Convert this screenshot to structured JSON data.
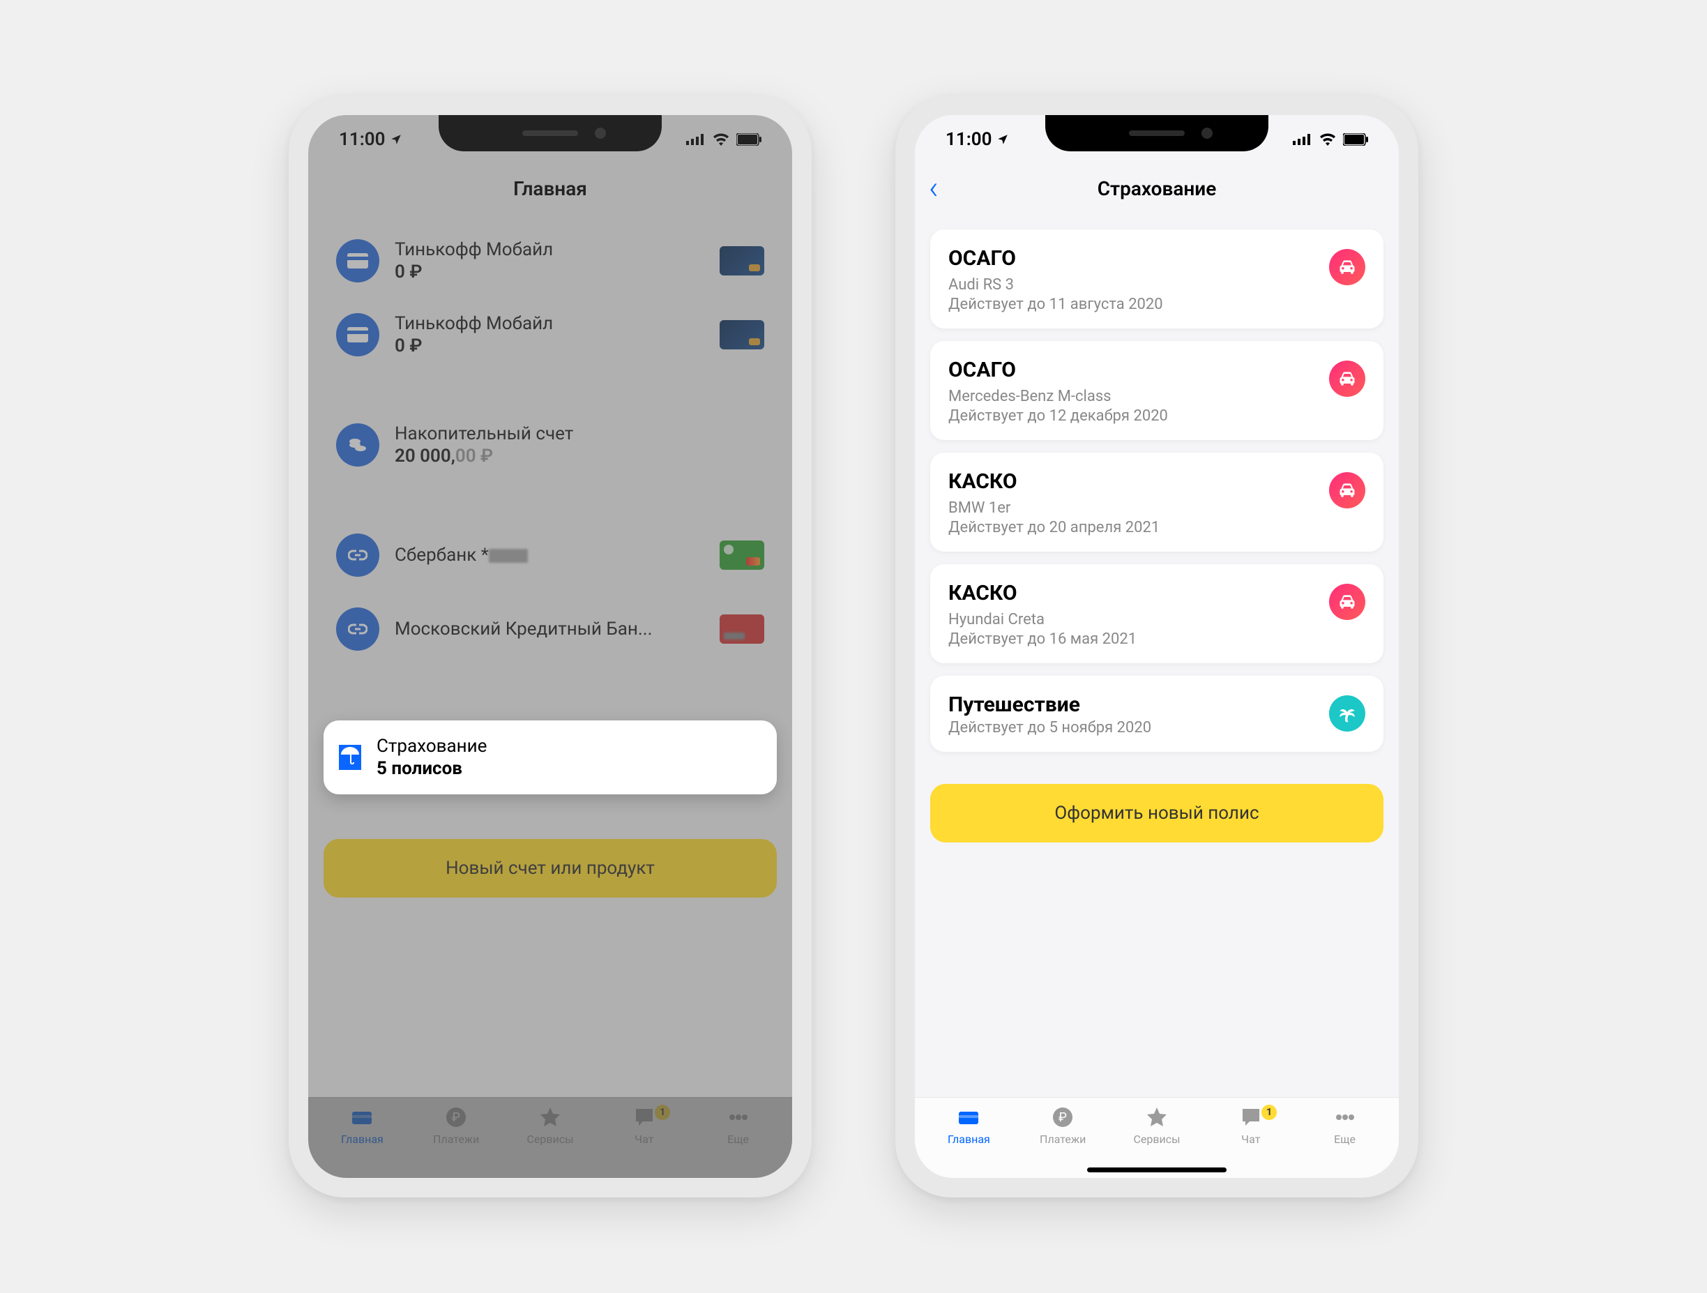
{
  "status": {
    "time": "11:00"
  },
  "phone1": {
    "title": "Главная",
    "accounts": [
      {
        "name": "Тинькофф Мобайл",
        "balance": "0 ₽",
        "card": "blue"
      },
      {
        "name": "Тинькофф Мобайл",
        "balance": "0 ₽",
        "card": "blue"
      }
    ],
    "savings": {
      "name": "Накопительный счет",
      "amount_main": "20 000,",
      "amount_fraction": "00 ₽"
    },
    "linked": [
      {
        "name": "Сбербанк *",
        "censored": "",
        "card": "green"
      },
      {
        "name": "Московский Кредитный Бан...",
        "card": "red"
      }
    ],
    "insurance": {
      "title": "Страхование",
      "count": "5 полисов"
    },
    "cta": "Новый счет или продукт"
  },
  "phone2": {
    "title": "Страхование",
    "policies": [
      {
        "title": "ОСАГО",
        "sub": "Audi RS 3",
        "valid": "Действует до 11 августа 2020",
        "icon": "car"
      },
      {
        "title": "ОСАГО",
        "sub": "Mercedes-Benz M-class",
        "valid": "Действует до 12 декабря 2020",
        "icon": "car"
      },
      {
        "title": "КАСКО",
        "sub": "BMW 1er",
        "valid": "Действует до 20 апреля 2021",
        "icon": "car"
      },
      {
        "title": "КАСКО",
        "sub": "Hyundai Creta",
        "valid": "Действует до 16 мая 2021",
        "icon": "car"
      },
      {
        "title": "Путешествие",
        "sub": "",
        "valid": "Действует до 5 ноября 2020",
        "icon": "palm"
      }
    ],
    "cta": "Оформить новый полис"
  },
  "tabs": [
    {
      "label": "Главная"
    },
    {
      "label": "Платежи"
    },
    {
      "label": "Сервисы"
    },
    {
      "label": "Чат",
      "badge": "1"
    },
    {
      "label": "Еще"
    }
  ]
}
